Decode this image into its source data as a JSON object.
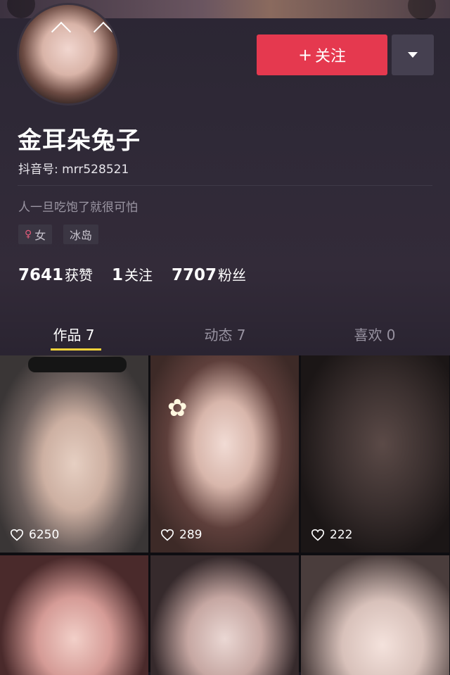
{
  "profile": {
    "follow_label": "关注",
    "follow_plus": "+",
    "name": "金耳朵兔子",
    "douyin_id": "抖音号: mrr528521",
    "bio": "人一旦吃饱了就很可怕",
    "tags": {
      "gender_icon": "♀",
      "gender": "女",
      "location": "冰岛"
    }
  },
  "stats": [
    {
      "num": "7641",
      "label": "获赞"
    },
    {
      "num": "1",
      "label": "关注"
    },
    {
      "num": "7707",
      "label": "粉丝"
    }
  ],
  "tabs": [
    {
      "label": "作品 7"
    },
    {
      "label": "动态 7"
    },
    {
      "label": "喜欢 0"
    }
  ],
  "videos": [
    {
      "likes": "6250"
    },
    {
      "likes": "289"
    },
    {
      "likes": "222"
    }
  ],
  "icons": {
    "heart": "heart-icon",
    "dropdown": "caret-down-icon"
  },
  "colors": {
    "follow": "#e5394f",
    "tab_underline": "#f4d23a"
  }
}
